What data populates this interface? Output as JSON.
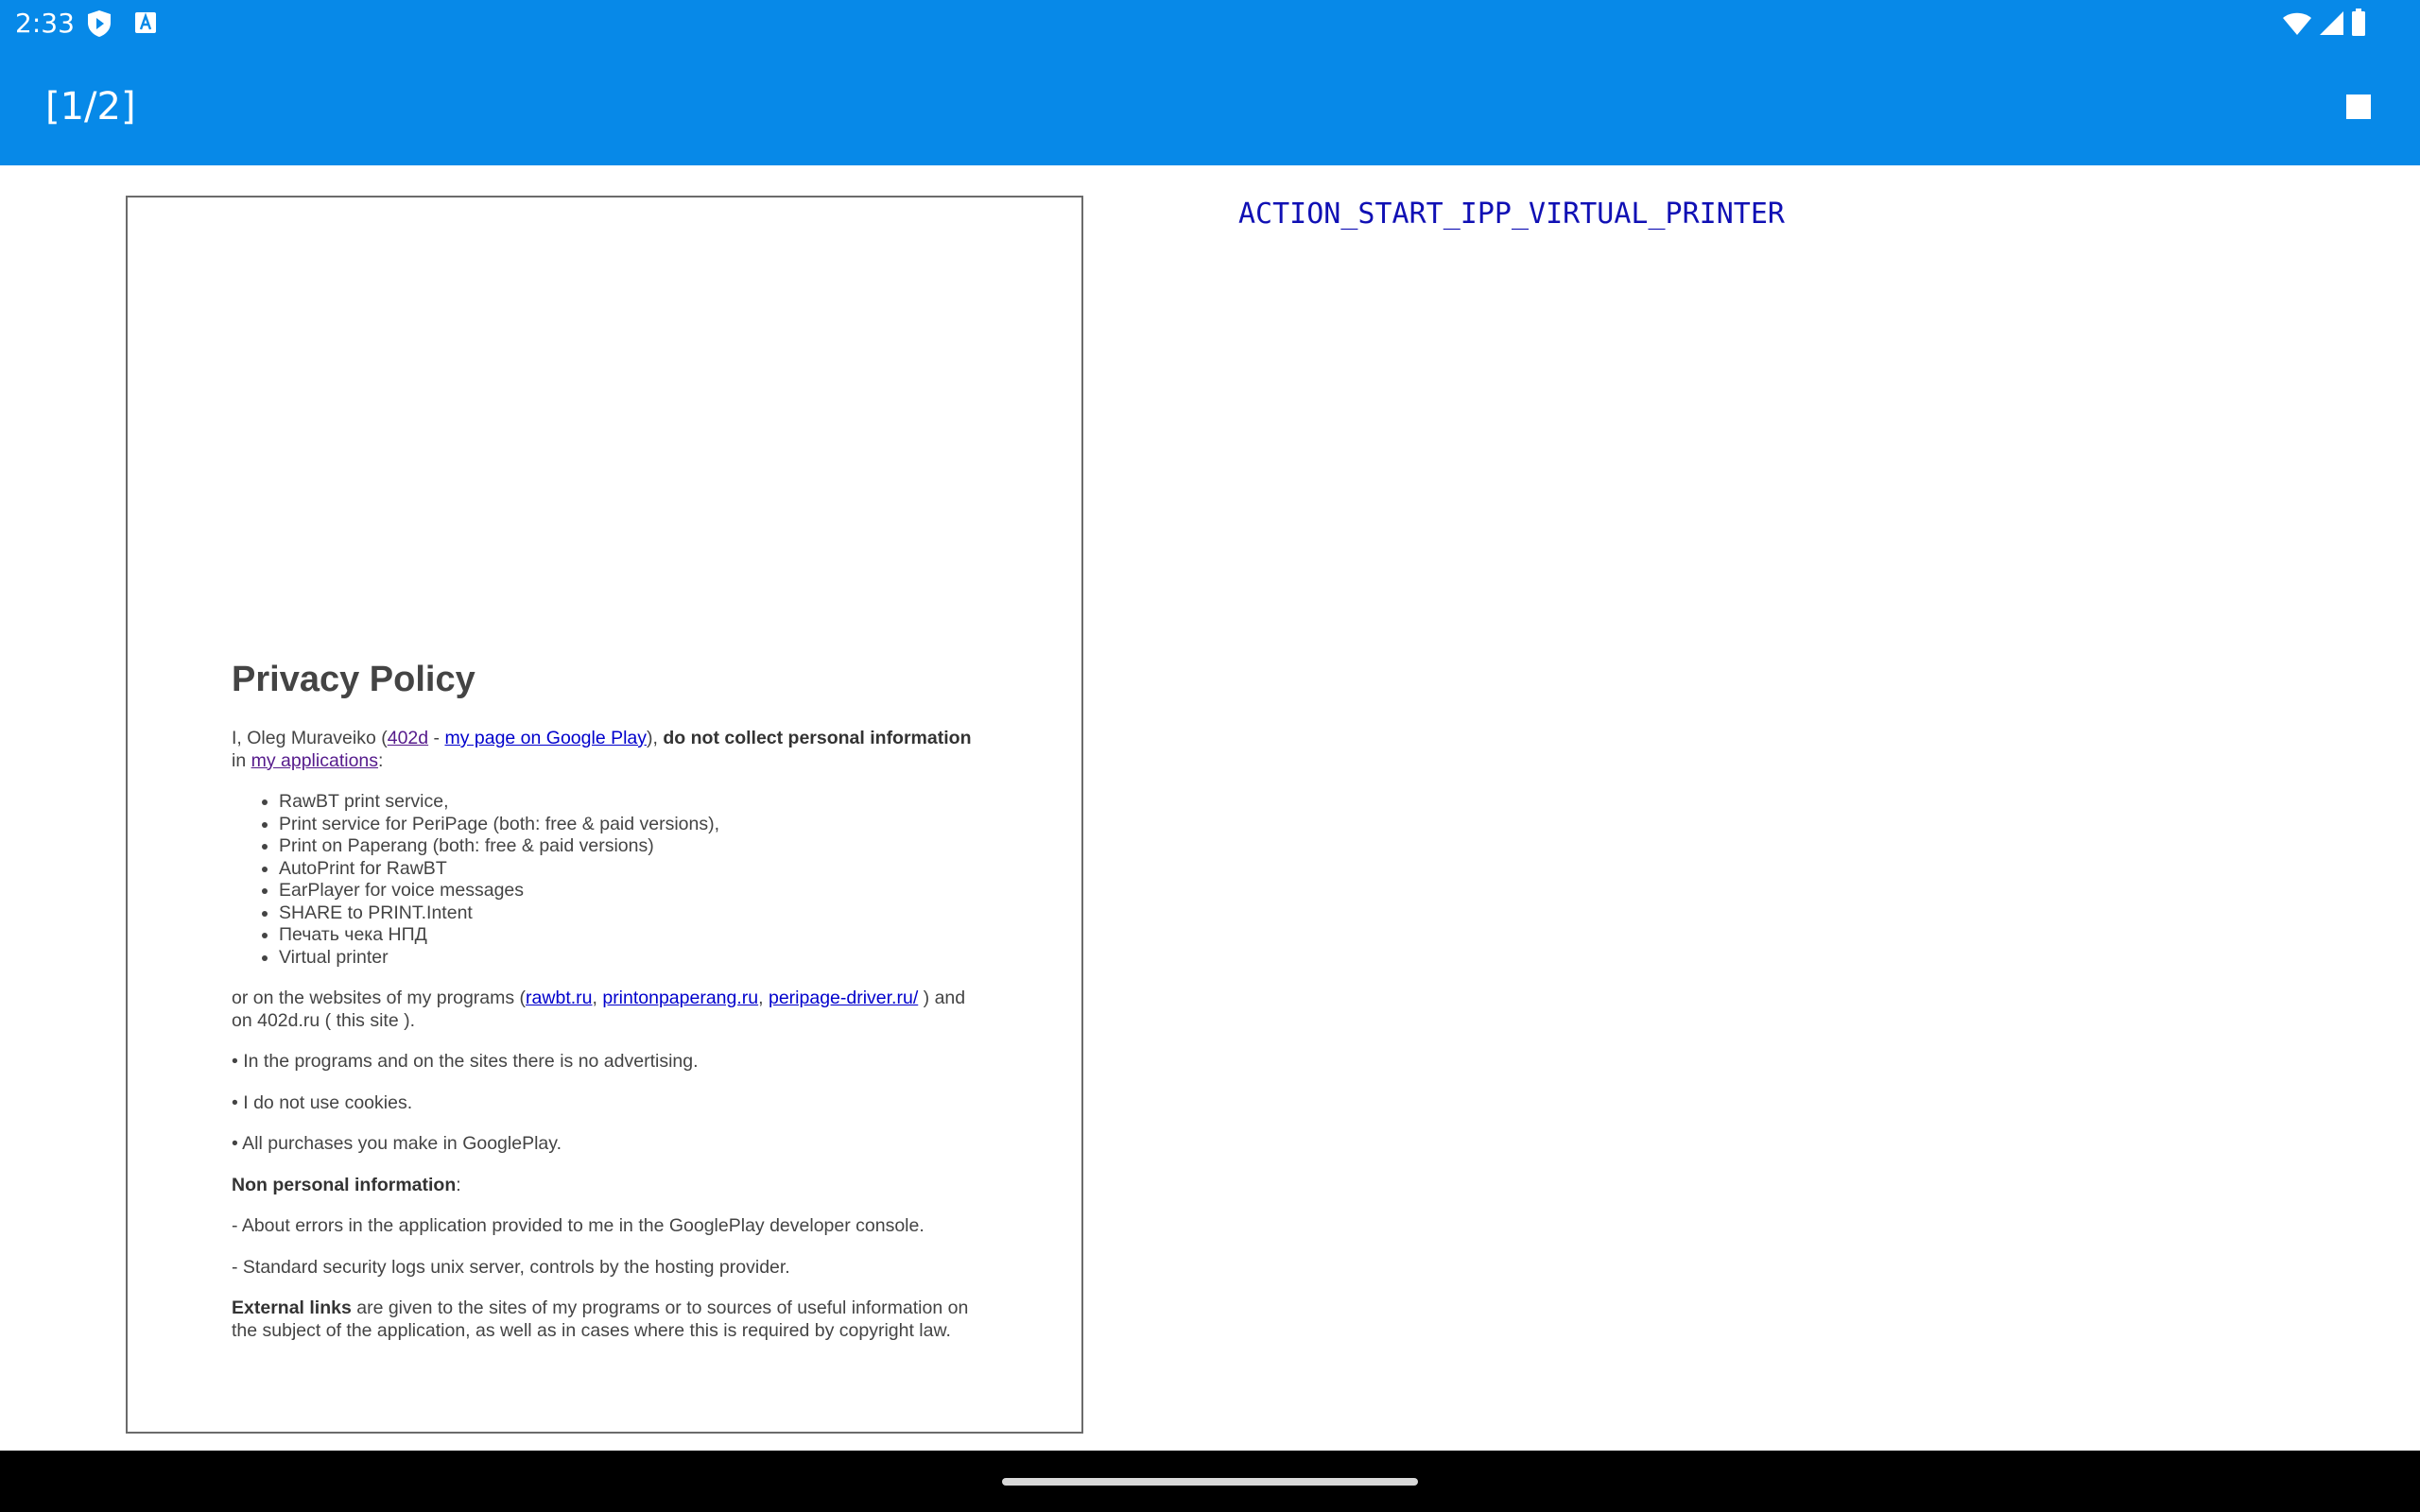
{
  "status_bar": {
    "time": "2:33",
    "left_icons": [
      "play-shield-icon",
      "a-box-icon"
    ],
    "right_icons": [
      "wifi-icon",
      "cell-signal-icon",
      "battery-icon"
    ]
  },
  "app_bar": {
    "page_indicator": "[1/2]",
    "stop_icon": "stop-icon",
    "color": "#0789e8"
  },
  "action_text": "ACTION_START_IPP_VIRTUAL_PRINTER",
  "document": {
    "title": "Privacy Policy",
    "intro": {
      "p1": "I, Oleg Muraveiko (",
      "link_402d": "402d",
      "sep": " - ",
      "link_google_play": "my page on Google Play",
      "p2": "), ",
      "bold": "do not collect personal information",
      "p3": " in ",
      "link_apps": "my applications",
      "p4": ":"
    },
    "apps": [
      "RawBT print service,",
      "Print service for PeriPage (both: free & paid versions),",
      "Print on Paperang (both: free & paid versions)",
      "AutoPrint for RawBT",
      "EarPlayer for voice messages",
      "SHARE to PRINT.Intent",
      "Печать чека НПД",
      "Virtual printer"
    ],
    "websites": {
      "p1": "or on the websites of my programs (",
      "link_rawbt": "rawbt.ru",
      "c1": ", ",
      "link_printonpaperang": "printonpaperang.ru",
      "c2": ", ",
      "link_peripage": "peripage-driver.ru/",
      "p2": " ) and on 402d.ru ( this site )."
    },
    "bullets": [
      "• In the programs and on the sites there is no advertising.",
      "• I do not use cookies.",
      "• All purchases you make in GooglePlay."
    ],
    "non_personal": {
      "label": "Non personal information",
      "colon": ":"
    },
    "non_personal_items": [
      "- About errors in the application provided to me in the GooglePlay developer console.",
      "- Standard security logs unix server, controls by the hosting provider."
    ],
    "external": {
      "label": "External links",
      "text": " are given to the sites of my programs or to sources of useful information on the subject of the application, as well as in cases where this is required by copyright law."
    }
  }
}
